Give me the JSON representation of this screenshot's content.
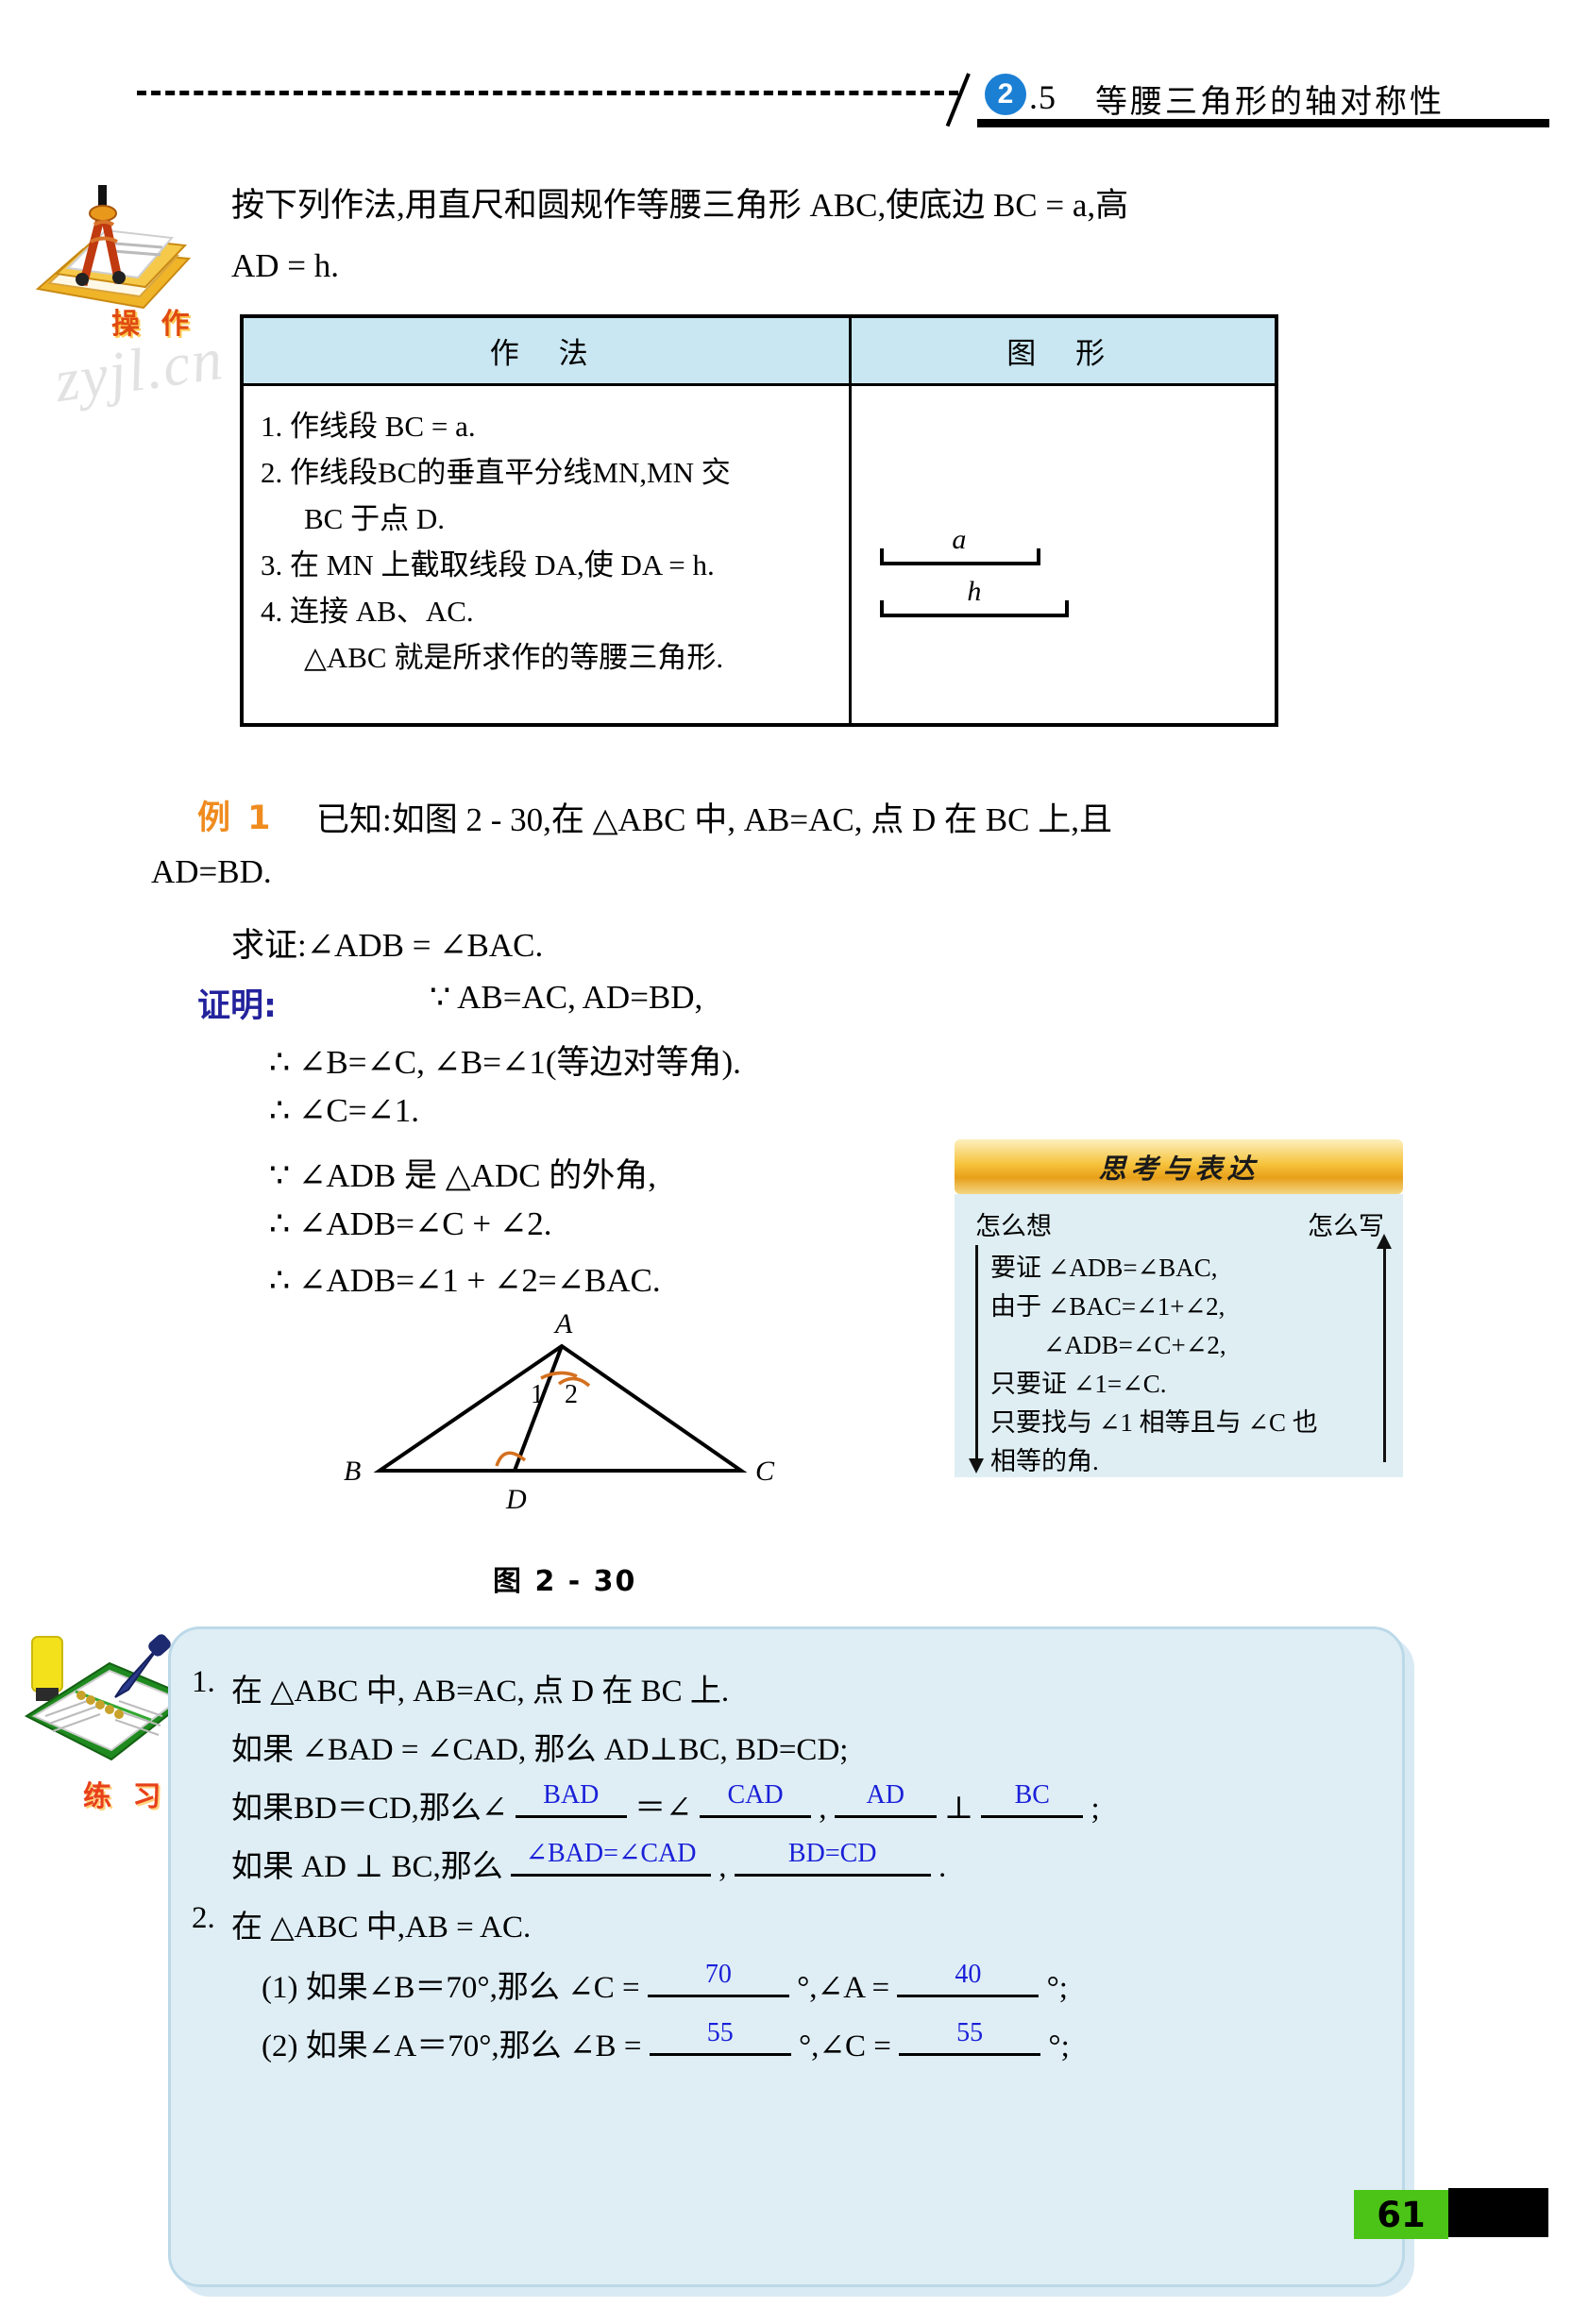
{
  "header": {
    "badge": "2",
    "number": ".5",
    "title": "等腰三角形的轴对称性"
  },
  "operation": {
    "icon_label": "操 作",
    "icon_name": "compass-on-books-icon",
    "intro_line1": "按下列作法,用直尺和圆规作等腰三角形 ABC,使底边 BC = a,高",
    "intro_line2": "AD = h."
  },
  "construction_table": {
    "headers": [
      "作  法",
      "图  形"
    ],
    "steps": [
      "1. 作线段 BC = a.",
      "2. 作线段BC的垂直平分线MN,MN 交",
      "BC 于点 D.",
      "3. 在 MN 上截取线段 DA,使 DA = h.",
      "4. 连接 AB、AC.",
      "△ABC 就是所求作的等腰三角形."
    ],
    "segments": [
      {
        "label": "a",
        "width": 110
      },
      {
        "label": "h",
        "width": 140
      }
    ]
  },
  "example": {
    "tag": "例 1",
    "line1": "已知:如图 2 - 30,在 △ABC 中, AB=AC, 点 D 在 BC 上,且",
    "line2": "AD=BD.",
    "goal": "求证:∠ADB = ∠BAC.",
    "proof_tag": "证明:",
    "proof_lines": [
      "∵ AB=AC,  AD=BD,",
      "∴ ∠B=∠C,  ∠B=∠1(等边对等角).",
      "∴ ∠C=∠1.",
      "∵ ∠ADB 是 △ADC 的外角,",
      "∴ ∠ADB=∠C + ∠2.",
      "∴ ∠ADB=∠1 + ∠2=∠BAC."
    ]
  },
  "thought_box": {
    "title": "思考与表达",
    "col_left": "怎么想",
    "col_right": "怎么写",
    "lines": [
      "要证 ∠ADB=∠BAC,",
      "由于 ∠BAC=∠1+∠2,",
      "∠ADB=∠C+∠2,",
      "只要证 ∠1=∠C.",
      "只要找与 ∠1 相等且与 ∠C 也",
      "相等的角."
    ]
  },
  "figure": {
    "caption": "图 2 - 30",
    "vertices": {
      "A": "A",
      "B": "B",
      "C": "C",
      "D": "D"
    },
    "angle_labels": [
      "1",
      "2"
    ],
    "arc_color": "#d4701f"
  },
  "practice": {
    "icon_label": "练 习",
    "icon_name": "notebook-pen-icon",
    "q1": {
      "num": "1.",
      "line1": "在 △ABC 中, AB=AC, 点 D 在 BC 上.",
      "line2": "如果 ∠BAD = ∠CAD, 那么 AD⊥BC, BD=CD;",
      "line3_pre": "如果BD＝CD,那么∠",
      "line3_a1": "BAD",
      "line3_mid1": "＝∠",
      "line3_a2": "CAD",
      "line3_mid2": ",",
      "line3_a3": "AD",
      "line3_mid3": "⊥",
      "line3_a4": "BC",
      "line3_end": ";",
      "line4_pre": "如果 AD ⊥ BC,那么",
      "line4_a1": "∠BAD=∠CAD",
      "line4_mid": ",",
      "line4_a2": "BD=CD",
      "line4_end": "."
    },
    "q2": {
      "num": "2.",
      "line1": "在 △ABC 中,AB = AC.",
      "sub1_pre": "(1) 如果∠B＝70°,那么 ∠C =",
      "sub1_a1": "70",
      "sub1_mid": "°,∠A =",
      "sub1_a2": "40",
      "sub1_end": "°;",
      "sub2_pre": "(2) 如果∠A＝70°,那么 ∠B =",
      "sub2_a1": "55",
      "sub2_mid": "°,∠C =",
      "sub2_a2": "55",
      "sub2_end": "°;"
    }
  },
  "page_number": "61",
  "watermark": "zyjl.cn",
  "colors": {
    "header_badge": "#1b7fd4",
    "table_header_bg": "#c9e7f2",
    "example_tag": "#ef8b1f",
    "proof_tag": "#23229c",
    "answer_ink": "#1a20d8",
    "practice_bg": "#dfeef5",
    "thought_header": "#f6c33c",
    "page_number_bg": "#4cc417"
  }
}
